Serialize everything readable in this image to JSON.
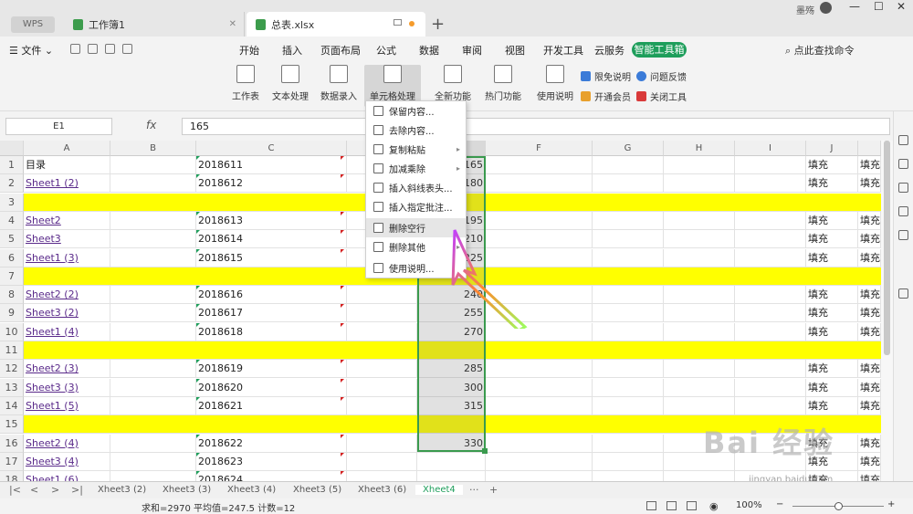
{
  "titlebar": {
    "tabs": [
      {
        "label": "WPS"
      },
      {
        "label": "工作簿1"
      },
      {
        "label": "总表.xlsx"
      }
    ],
    "user": "墨殇",
    "add": "+"
  },
  "menubar": {
    "file": "文件",
    "items": [
      "开始",
      "插入",
      "页面布局",
      "公式",
      "数据",
      "审阅",
      "视图",
      "开发工具",
      "云服务",
      "智能工具箱"
    ],
    "search": "点此查找命令"
  },
  "ribbon": {
    "buttons": [
      "工作表",
      "文本处理",
      "数据录入",
      "单元格处理",
      "全新功能",
      "热门功能",
      "使用说明"
    ],
    "small": [
      "限免说明",
      "问题反馈",
      "开通会员",
      "关闭工具"
    ]
  },
  "formula": {
    "namebox": "E1",
    "fx": "fx",
    "value": "165"
  },
  "columns": [
    "A",
    "B",
    "C",
    "D",
    "E",
    "F",
    "G",
    "H",
    "I",
    "J"
  ],
  "rows": [
    {
      "n": "1",
      "a": "目录",
      "c": "2018611",
      "e": "165",
      "j": "填充",
      "k": "填充",
      "yellow": false
    },
    {
      "n": "2",
      "a": "Sheet1 (2)",
      "c": "2018612",
      "e": "180",
      "j": "填充",
      "k": "填充",
      "yellow": false
    },
    {
      "n": "3",
      "a": "",
      "c": "",
      "e": "",
      "j": "",
      "k": "",
      "yellow": true
    },
    {
      "n": "4",
      "a": "Sheet2",
      "c": "2018613",
      "e": "195",
      "j": "填充",
      "k": "填充",
      "yellow": false
    },
    {
      "n": "5",
      "a": "Sheet3",
      "c": "2018614",
      "e": "210",
      "j": "填充",
      "k": "填充",
      "yellow": false
    },
    {
      "n": "6",
      "a": "Sheet1 (3)",
      "c": "2018615",
      "e": "225",
      "j": "填充",
      "k": "填充",
      "yellow": false
    },
    {
      "n": "7",
      "a": "",
      "c": "",
      "e": "",
      "j": "",
      "k": "",
      "yellow": true
    },
    {
      "n": "8",
      "a": "Sheet2 (2)",
      "c": "2018616",
      "e": "240",
      "j": "填充",
      "k": "填充",
      "yellow": false
    },
    {
      "n": "9",
      "a": "Sheet3 (2)",
      "c": "2018617",
      "e": "255",
      "j": "填充",
      "k": "填充",
      "yellow": false
    },
    {
      "n": "10",
      "a": "Sheet1 (4)",
      "c": "2018618",
      "e": "270",
      "j": "填充",
      "k": "填充",
      "yellow": false
    },
    {
      "n": "11",
      "a": "",
      "c": "",
      "e": "",
      "j": "",
      "k": "",
      "yellow": true
    },
    {
      "n": "12",
      "a": "Sheet2 (3)",
      "c": "2018619",
      "e": "285",
      "j": "填充",
      "k": "填充",
      "yellow": false
    },
    {
      "n": "13",
      "a": "Sheet3 (3)",
      "c": "2018620",
      "e": "300",
      "j": "填充",
      "k": "填充",
      "yellow": false
    },
    {
      "n": "14",
      "a": "Sheet1 (5)",
      "c": "2018621",
      "e": "315",
      "j": "填充",
      "k": "填充",
      "yellow": false
    },
    {
      "n": "15",
      "a": "",
      "c": "",
      "e": "",
      "j": "",
      "k": "",
      "yellow": true
    },
    {
      "n": "16",
      "a": "Sheet2 (4)",
      "c": "2018622",
      "e": "330",
      "j": "填充",
      "k": "填充",
      "yellow": false
    },
    {
      "n": "17",
      "a": "Sheet3 (4)",
      "c": "2018623",
      "e": "",
      "j": "填充",
      "k": "填充",
      "yellow": false
    },
    {
      "n": "18",
      "a": "Sheet1 (6)",
      "c": "2018624",
      "e": "",
      "j": "填充",
      "k": "填充",
      "yellow": false
    }
  ],
  "dropdown": {
    "items": [
      "保留内容...",
      "去除内容...",
      "复制粘贴",
      "加减乘除",
      "插入斜线表头...",
      "插入指定批注...",
      "删除空行",
      "删除其他",
      "使用说明..."
    ]
  },
  "sheettabs": [
    "Xheet3 (2)",
    "Xheet3 (3)",
    "Xheet3 (4)",
    "Xheet3 (5)",
    "Xheet3 (6)",
    "Xheet4"
  ],
  "sheetbar": {
    "more": "···",
    "add": "+"
  },
  "status": {
    "sum": "求和=2970  平均值=247.5  计数=12",
    "zoom": "100%"
  },
  "watermark": {
    "main": "Bai 经验",
    "sub": "jingyan.baidu.com"
  },
  "colors": {
    "accent": "#1e9e5b",
    "highlight": "#ffff00",
    "selection": "#3a9a4e"
  }
}
